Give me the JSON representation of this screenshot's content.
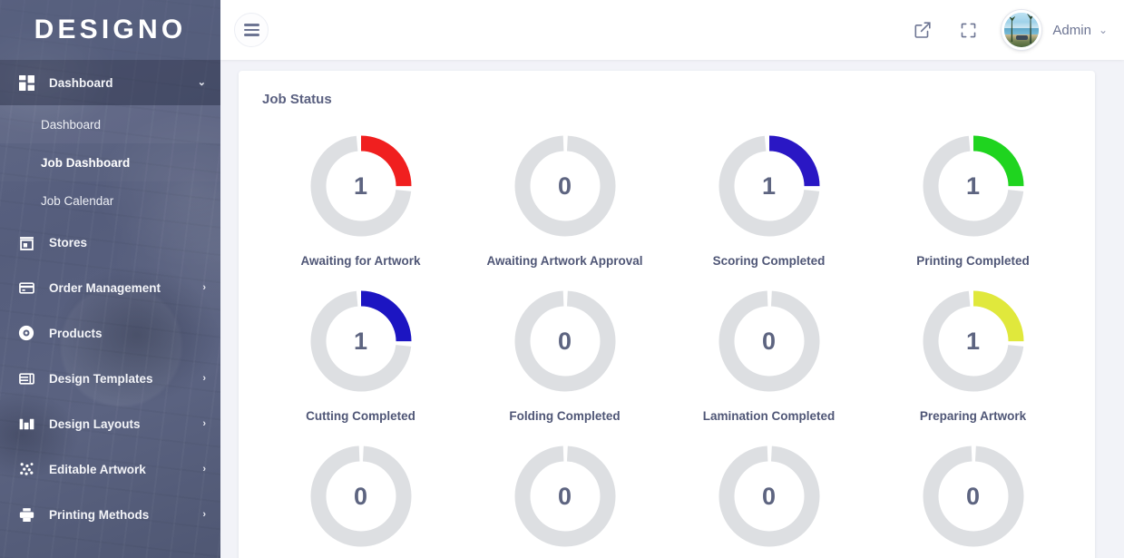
{
  "brand": {
    "name": "DESIGNO"
  },
  "topbar": {
    "menu_toggle": "menu-toggle",
    "external_link_icon": "external-link-icon",
    "fullscreen_icon": "fullscreen-icon",
    "avatar_icon": "user-avatar",
    "username": "Admin",
    "user_caret": "⌄"
  },
  "sidebar": {
    "items": [
      {
        "label": "Dashboard",
        "icon": "dashboard-grid-icon",
        "caret": "⌄",
        "active": true,
        "expanded": true
      },
      {
        "label": "Stores",
        "icon": "store-icon",
        "caret": "",
        "active": false,
        "expanded": false
      },
      {
        "label": "Order Management",
        "icon": "credit-card-icon",
        "caret": "›",
        "active": false,
        "expanded": false
      },
      {
        "label": "Products",
        "icon": "disc-icon",
        "caret": "",
        "active": false,
        "expanded": false
      },
      {
        "label": "Design Templates",
        "icon": "template-icon",
        "caret": "›",
        "active": false,
        "expanded": false
      },
      {
        "label": "Design Layouts",
        "icon": "layout-icon",
        "caret": "›",
        "active": false,
        "expanded": false
      },
      {
        "label": "Editable Artwork",
        "icon": "dots-scatter-icon",
        "caret": "›",
        "active": false,
        "expanded": false
      },
      {
        "label": "Printing Methods",
        "icon": "printer-icon",
        "caret": "›",
        "active": false,
        "expanded": false
      }
    ],
    "submenu": [
      {
        "label": "Dashboard",
        "current": false
      },
      {
        "label": "Job Dashboard",
        "current": true
      },
      {
        "label": "Job Calendar",
        "current": false
      }
    ]
  },
  "main": {
    "card_title": "Job Status"
  },
  "chart_data": {
    "type": "pie",
    "title": "Job Status",
    "subtitle": "",
    "legend_position": "below-each",
    "grid": false,
    "max_value": 4,
    "track_color": "#dddfe2",
    "gap_degrees": 6,
    "items": [
      {
        "label": "Awaiting for Artwork",
        "value": 1,
        "color": "#f01f1f",
        "percent": 25
      },
      {
        "label": "Awaiting Artwork Approval",
        "value": 0,
        "color": "#dddfe2",
        "percent": 0
      },
      {
        "label": "Scoring Completed",
        "value": 1,
        "color": "#2a17c4",
        "percent": 25
      },
      {
        "label": "Printing Completed",
        "value": 1,
        "color": "#1fd41f",
        "percent": 25
      },
      {
        "label": "Cutting Completed",
        "value": 1,
        "color": "#1c15c2",
        "percent": 25
      },
      {
        "label": "Folding Completed",
        "value": 0,
        "color": "#dddfe2",
        "percent": 0
      },
      {
        "label": "Lamination Completed",
        "value": 0,
        "color": "#dddfe2",
        "percent": 0
      },
      {
        "label": "Preparing Artwork",
        "value": 1,
        "color": "#e0e83c",
        "percent": 25
      },
      {
        "label": "",
        "value": 0,
        "color": "#dddfe2",
        "percent": 0
      },
      {
        "label": "",
        "value": 0,
        "color": "#dddfe2",
        "percent": 0
      },
      {
        "label": "",
        "value": 0,
        "color": "#dddfe2",
        "percent": 0
      },
      {
        "label": "",
        "value": 0,
        "color": "#dddfe2",
        "percent": 0
      }
    ]
  }
}
